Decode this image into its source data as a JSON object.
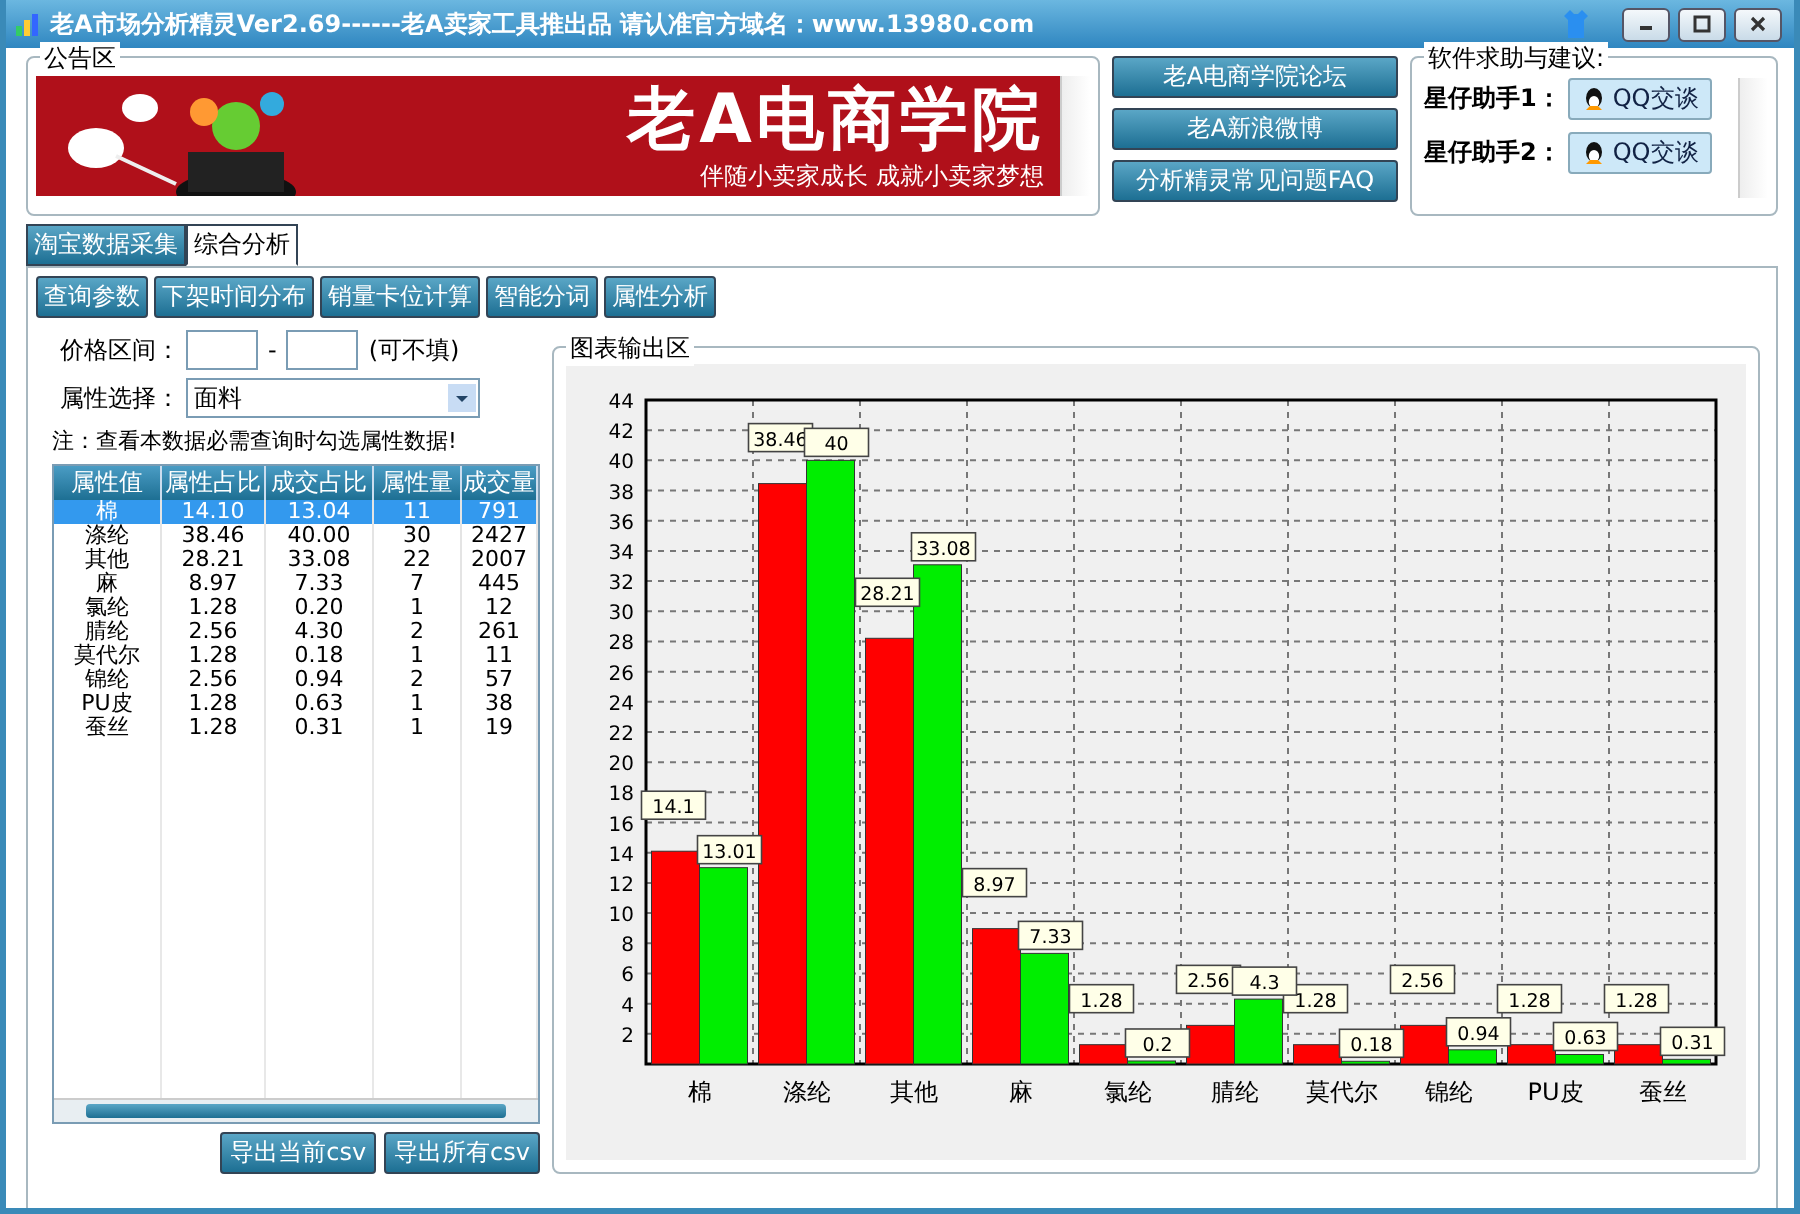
{
  "window": {
    "title": "老A市场分析精灵Ver2.69------老A卖家工具推出品  请认准官方域名：www.13980.com"
  },
  "notice": {
    "title": "公告区",
    "banner_title": "老A电商学院",
    "banner_slogan": "伴随小卖家成长  成就小卖家梦想"
  },
  "links": [
    "老A电商学院论坛",
    "老A新浪微博",
    "分析精灵常见问题FAQ"
  ],
  "help": {
    "title": "软件求助与建议:",
    "rows": [
      {
        "label": "星仔助手1：",
        "button": "QQ交谈"
      },
      {
        "label": "星仔助手2：",
        "button": "QQ交谈"
      }
    ]
  },
  "tabs": [
    {
      "label": "淘宝数据采集",
      "selected": false
    },
    {
      "label": "综合分析",
      "selected": true
    }
  ],
  "toolbar": [
    "查询参数",
    "下架时间分布",
    "销量卡位计算",
    "智能分词",
    "属性分析"
  ],
  "filters": {
    "price_label": "价格区间：",
    "dash": "-",
    "optional": "(可不填)",
    "attr_label": "属性选择：",
    "attr_value": "面料",
    "note": "注：查看本数据必需查询时勾选属性数据!"
  },
  "table": {
    "columns": [
      "属性值",
      "属性占比",
      "成交占比",
      "属性量",
      "成交量"
    ],
    "rows": [
      {
        "cells": [
          "棉",
          "14.10",
          "13.04",
          "11",
          "791"
        ],
        "selected": true
      },
      {
        "cells": [
          "涤纶",
          "38.46",
          "40.00",
          "30",
          "2427"
        ],
        "selected": false
      },
      {
        "cells": [
          "其他",
          "28.21",
          "33.08",
          "22",
          "2007"
        ],
        "selected": false
      },
      {
        "cells": [
          "麻",
          "8.97",
          "7.33",
          "7",
          "445"
        ],
        "selected": false
      },
      {
        "cells": [
          "氯纶",
          "1.28",
          "0.20",
          "1",
          "12"
        ],
        "selected": false
      },
      {
        "cells": [
          "腈纶",
          "2.56",
          "4.30",
          "2",
          "261"
        ],
        "selected": false
      },
      {
        "cells": [
          "莫代尔",
          "1.28",
          "0.18",
          "1",
          "11"
        ],
        "selected": false
      },
      {
        "cells": [
          "锦纶",
          "2.56",
          "0.94",
          "2",
          "57"
        ],
        "selected": false
      },
      {
        "cells": [
          "PU皮",
          "1.28",
          "0.63",
          "1",
          "38"
        ],
        "selected": false
      },
      {
        "cells": [
          "蚕丝",
          "1.28",
          "0.31",
          "1",
          "19"
        ],
        "selected": false
      }
    ]
  },
  "export_buttons": [
    "导出当前csv",
    "导出所有csv"
  ],
  "chart": {
    "title": "图表输出区",
    "chart_data": {
      "type": "bar",
      "categories": [
        "棉",
        "涤纶",
        "其他",
        "麻",
        "氯纶",
        "腈纶",
        "莫代尔",
        "锦纶",
        "PU皮",
        "蚕丝"
      ],
      "series": [
        {
          "color": "#ff0000",
          "values": [
            14.1,
            38.46,
            28.21,
            8.97,
            1.28,
            2.56,
            1.28,
            2.56,
            1.28,
            1.28
          ]
        },
        {
          "color": "#00ee00",
          "values": [
            13.01,
            40,
            33.08,
            7.33,
            0.2,
            4.3,
            0.18,
            0.94,
            0.63,
            0.31
          ]
        }
      ],
      "ylim": [
        0,
        44
      ],
      "yticks": [
        2,
        4,
        6,
        8,
        10,
        12,
        14,
        16,
        18,
        20,
        22,
        24,
        26,
        28,
        30,
        32,
        34,
        36,
        38,
        40,
        42,
        44
      ],
      "grid": true,
      "data_labels": true
    }
  }
}
